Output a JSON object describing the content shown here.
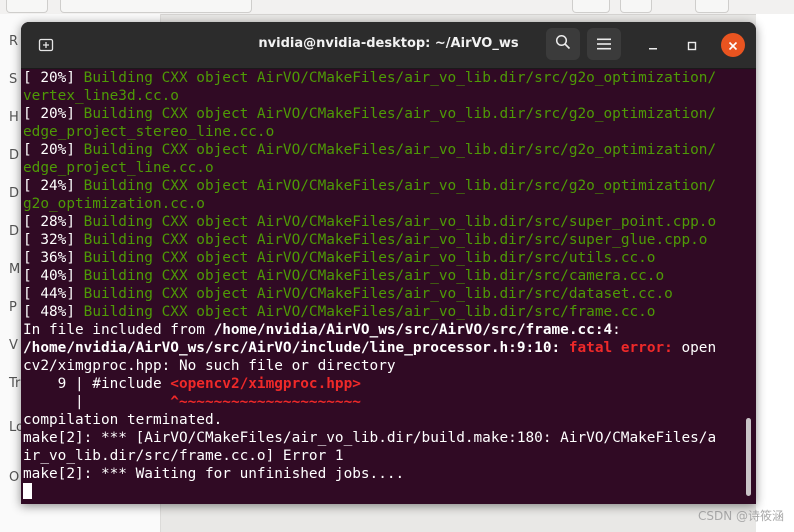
{
  "window": {
    "title": "nvidia@nvidia-desktop: ~/AirVO_ws"
  },
  "background": {
    "sidebar_letters": [
      "R",
      "S",
      "H",
      "D",
      "D",
      "D",
      "M",
      "P",
      "V",
      "Tr",
      "Lo",
      "O"
    ]
  },
  "watermark": "CSDN @诗筱涵",
  "terminal_lines": [
    [
      {
        "t": "[ 20%] ",
        "c": "w"
      },
      {
        "t": "Building CXX object AirVO/CMakeFiles/air_vo_lib.dir/src/g2o_optimization/",
        "c": "g"
      }
    ],
    [
      {
        "t": "vertex_line3d.cc.o",
        "c": "g"
      }
    ],
    [
      {
        "t": "[ 20%] ",
        "c": "w"
      },
      {
        "t": "Building CXX object AirVO/CMakeFiles/air_vo_lib.dir/src/g2o_optimization/",
        "c": "g"
      }
    ],
    [
      {
        "t": "edge_project_stereo_line.cc.o",
        "c": "g"
      }
    ],
    [
      {
        "t": "[ 20%] ",
        "c": "w"
      },
      {
        "t": "Building CXX object AirVO/CMakeFiles/air_vo_lib.dir/src/g2o_optimization/",
        "c": "g"
      }
    ],
    [
      {
        "t": "edge_project_line.cc.o",
        "c": "g"
      }
    ],
    [
      {
        "t": "[ 24%] ",
        "c": "w"
      },
      {
        "t": "Building CXX object AirVO/CMakeFiles/air_vo_lib.dir/src/g2o_optimization/",
        "c": "g"
      }
    ],
    [
      {
        "t": "g2o_optimization.cc.o",
        "c": "g"
      }
    ],
    [
      {
        "t": "[ 28%] ",
        "c": "w"
      },
      {
        "t": "Building CXX object AirVO/CMakeFiles/air_vo_lib.dir/src/super_point.cpp.o",
        "c": "g"
      }
    ],
    [
      {
        "t": "[ 32%] ",
        "c": "w"
      },
      {
        "t": "Building CXX object AirVO/CMakeFiles/air_vo_lib.dir/src/super_glue.cpp.o",
        "c": "g"
      }
    ],
    [
      {
        "t": "[ 36%] ",
        "c": "w"
      },
      {
        "t": "Building CXX object AirVO/CMakeFiles/air_vo_lib.dir/src/utils.cc.o",
        "c": "g"
      }
    ],
    [
      {
        "t": "[ 40%] ",
        "c": "w"
      },
      {
        "t": "Building CXX object AirVO/CMakeFiles/air_vo_lib.dir/src/camera.cc.o",
        "c": "g"
      }
    ],
    [
      {
        "t": "[ 44%] ",
        "c": "w"
      },
      {
        "t": "Building CXX object AirVO/CMakeFiles/air_vo_lib.dir/src/dataset.cc.o",
        "c": "g"
      }
    ],
    [
      {
        "t": "[ 48%] ",
        "c": "w"
      },
      {
        "t": "Building CXX object AirVO/CMakeFiles/air_vo_lib.dir/src/frame.cc.o",
        "c": "g"
      }
    ],
    [
      {
        "t": "In file included from ",
        "c": "w"
      },
      {
        "t": "/home/nvidia/AirVO_ws/src/AirVO/src/frame.cc:4",
        "c": "b"
      },
      {
        "t": ":",
        "c": "w"
      }
    ],
    [
      {
        "t": "/home/nvidia/AirVO_ws/src/AirVO/include/line_processor.h:9:10:",
        "c": "b"
      },
      {
        "t": " ",
        "c": "w"
      },
      {
        "t": "fatal error:",
        "c": "r"
      },
      {
        "t": " open",
        "c": "w"
      }
    ],
    [
      {
        "t": "cv2/ximgproc.hpp: No such file or directory",
        "c": "w"
      }
    ],
    [
      {
        "t": "    9 | #include ",
        "c": "w"
      },
      {
        "t": "<opencv2/ximgproc.hpp>",
        "c": "r"
      }
    ],
    [
      {
        "t": "      |          ",
        "c": "w"
      },
      {
        "t": "^~~~~~~~~~~~~~~~~~~~~~",
        "c": "r"
      }
    ],
    [
      {
        "t": "compilation terminated.",
        "c": "w"
      }
    ],
    [
      {
        "t": "make[2]: *** [AirVO/CMakeFiles/air_vo_lib.dir/build.make:180: AirVO/CMakeFiles/a",
        "c": "w"
      }
    ],
    [
      {
        "t": "ir_vo_lib.dir/src/frame.cc.o] Error 1",
        "c": "w"
      }
    ],
    [
      {
        "t": "make[2]: *** Waiting for unfinished jobs....",
        "c": "w"
      }
    ]
  ],
  "colors": {
    "terminal_bg": "#300a24",
    "green": "#4e9a06",
    "red": "#ef2929",
    "close_button": "#e95420"
  },
  "icons": [
    "new-tab-icon",
    "search-icon",
    "hamburger-menu-icon",
    "minimize-icon",
    "maximize-icon",
    "close-icon"
  ]
}
